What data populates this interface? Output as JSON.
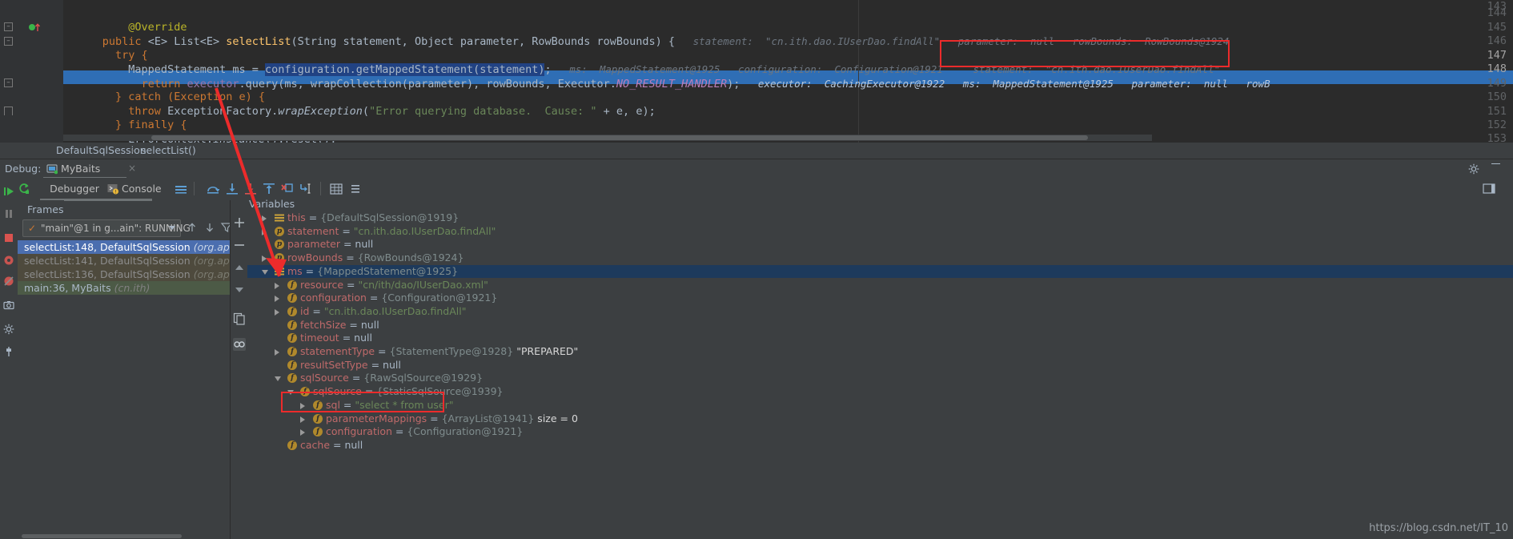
{
  "editor": {
    "lines": [
      {
        "num": "144",
        "indent": 0
      },
      {
        "num": "145",
        "indent": 0
      },
      {
        "num": "146",
        "indent": 0
      },
      {
        "num": "147",
        "indent": 0
      },
      {
        "num": "148",
        "indent": 0
      },
      {
        "num": "149",
        "indent": 0
      },
      {
        "num": "150",
        "indent": 0
      },
      {
        "num": "151",
        "indent": 0
      },
      {
        "num": "152",
        "indent": 0
      },
      {
        "num": "153",
        "indent": 0
      }
    ],
    "line144": {
      "annotation": "@Override"
    },
    "line145": {
      "kw_public": "public",
      "generic": " <E> ",
      "type": "List<E> ",
      "method": "selectList",
      "sig": "(String statement, Object parameter, RowBounds rowBounds) {",
      "hint1": "statement:  \"cn.ith.dao.IUserDao.findAll\"",
      "hint2": "parameter:  null",
      "hint3": "rowBounds:  RowBounds@1924"
    },
    "line146": {
      "text": "try {"
    },
    "line147": {
      "pre": "MappedStatement ms = ",
      "sel": "configuration.getMappedStatement(statement)",
      "post": ";",
      "hint1": "ms:  MappedStatement@1925",
      "hint2": "configuration:  Configuration@1921",
      "hint3": "statement:  \"cn.ith.dao.IUserDao.findAll\""
    },
    "line148": {
      "kw": "return ",
      "expr_a": "executor",
      "expr_b": ".query(ms, wrapCollection(parameter), rowBounds, Executor.",
      "const": "NO_RESULT_HANDLER",
      "expr_c": ");",
      "hint1": "executor:  CachingExecutor@1922",
      "hint2": "ms:  MappedStatement@1925",
      "hint3": "parameter:  null",
      "hint4": "rowB"
    },
    "line149": {
      "text": "} catch (Exception e) {"
    },
    "line150": {
      "kw": "throw ",
      "cls": "ExceptionFactory.",
      "method": "wrapException",
      "open": "(",
      "str": "\"Error querying database.  Cause: \"",
      "tail": " + e, e);"
    },
    "line151": {
      "text": "} finally {"
    },
    "line152": {
      "cls": "ErrorContext.",
      "method": "instance",
      "tail": "().reset();"
    },
    "line153": {
      "text": "}"
    }
  },
  "breadcrumb": {
    "class_name": "DefaultSqlSession",
    "separator": "›",
    "method_name": "selectList()"
  },
  "debug_header": {
    "label": "Debug:",
    "tab_name": "MyBaits",
    "close_label": "×",
    "settings_icon": "gear-icon",
    "minimize_icon": "minimize-icon"
  },
  "debug_tabs": [
    {
      "label": "Debugger",
      "active": true
    },
    {
      "label": "Console",
      "active": false
    }
  ],
  "toolbar_icons": [
    "show-execution-point-icon",
    "step-over-icon",
    "step-into-icon",
    "force-step-into-icon",
    "step-out-icon",
    "drop-frame-icon",
    "run-to-cursor-icon",
    "evaluate-expression-icon",
    "more-icon"
  ],
  "rail_icons": [
    "resume-program-icon",
    "pause-program-icon",
    "stop-icon",
    "view-breakpoints-icon",
    "mute-breakpoints-icon",
    "camera-icon",
    "settings-icon",
    "pin-icon"
  ],
  "frames": {
    "header": "Frames",
    "thread_selector": "\"main\"@1 in g...ain\": RUNNING",
    "items": [
      {
        "method": "selectList:148, DefaultSqlSession",
        "pkg": "(org.apache.ibatis.s",
        "state": "selected"
      },
      {
        "method": "selectList:141, DefaultSqlSession",
        "pkg": "(org.apache.ibatis.s",
        "state": "library"
      },
      {
        "method": "selectList:136, DefaultSqlSession",
        "pkg": "(org.apache.ibatis.s",
        "state": "library"
      },
      {
        "method": "main:36, MyBaits",
        "pkg": "(cn.ith)",
        "state": "user"
      }
    ]
  },
  "variables": {
    "header": "Variables",
    "rows": [
      {
        "indent": 0,
        "arrow": "closed",
        "icon": "localvar",
        "icon_char": "",
        "name": "this",
        "eq": " = ",
        "value": "{DefaultSqlSession@1919}",
        "vtype": "obj",
        "selected": false,
        "clipped": true
      },
      {
        "indent": 0,
        "arrow": "closed",
        "icon": "param",
        "icon_char": "p",
        "name": "statement",
        "eq": " = ",
        "value": "\"cn.ith.dao.IUserDao.findAll\"",
        "vtype": "str",
        "selected": false
      },
      {
        "indent": 0,
        "arrow": "none",
        "icon": "param",
        "icon_char": "p",
        "name": "parameter",
        "eq": " = ",
        "value": "null",
        "vtype": "null",
        "selected": false
      },
      {
        "indent": 0,
        "arrow": "closed",
        "icon": "param",
        "icon_char": "p",
        "name": "rowBounds",
        "eq": " = ",
        "value": "{RowBounds@1924}",
        "vtype": "obj",
        "selected": false
      },
      {
        "indent": 0,
        "arrow": "open",
        "icon": "localvar",
        "icon_char": "",
        "name": "ms",
        "eq": " = ",
        "value": "{MappedStatement@1925}",
        "vtype": "obj",
        "selected": true
      },
      {
        "indent": 1,
        "arrow": "closed",
        "icon": "field",
        "icon_char": "f",
        "name": "resource",
        "eq": " = ",
        "value": "\"cn/ith/dao/IUserDao.xml\"",
        "vtype": "str",
        "selected": false
      },
      {
        "indent": 1,
        "arrow": "closed",
        "icon": "field",
        "icon_char": "f",
        "name": "configuration",
        "eq": " = ",
        "value": "{Configuration@1921}",
        "vtype": "obj",
        "selected": false
      },
      {
        "indent": 1,
        "arrow": "closed",
        "icon": "field",
        "icon_char": "f",
        "name": "id",
        "eq": " = ",
        "value": "\"cn.ith.dao.IUserDao.findAll\"",
        "vtype": "str",
        "selected": false
      },
      {
        "indent": 1,
        "arrow": "none",
        "icon": "field",
        "icon_char": "f",
        "name": "fetchSize",
        "eq": " = ",
        "value": "null",
        "vtype": "null",
        "selected": false
      },
      {
        "indent": 1,
        "arrow": "none",
        "icon": "field",
        "icon_char": "f",
        "name": "timeout",
        "eq": " = ",
        "value": "null",
        "vtype": "null",
        "selected": false
      },
      {
        "indent": 1,
        "arrow": "closed",
        "icon": "field",
        "icon_char": "f",
        "name": "statementType",
        "eq": " = ",
        "value": "{StatementType@1928}",
        "vtype": "obj",
        "extra": "\"PREPARED\"",
        "selected": false
      },
      {
        "indent": 1,
        "arrow": "none",
        "icon": "field",
        "icon_char": "f",
        "name": "resultSetType",
        "eq": " = ",
        "value": "null",
        "vtype": "null",
        "selected": false
      },
      {
        "indent": 1,
        "arrow": "open",
        "icon": "field",
        "icon_char": "f",
        "name": "sqlSource",
        "eq": " = ",
        "value": "{RawSqlSource@1929}",
        "vtype": "obj",
        "selected": false
      },
      {
        "indent": 2,
        "arrow": "open",
        "icon": "field",
        "icon_char": "f",
        "name": "sqlSource",
        "eq": " = ",
        "value": "{StaticSqlSource@1939}",
        "vtype": "obj",
        "selected": false
      },
      {
        "indent": 3,
        "arrow": "closed",
        "icon": "field",
        "icon_char": "f",
        "name": "sql",
        "eq": " = ",
        "value": "\"select * from user\"",
        "vtype": "str",
        "selected": false,
        "highlighted": true
      },
      {
        "indent": 3,
        "arrow": "closed",
        "icon": "field",
        "icon_char": "f",
        "name": "parameterMappings",
        "eq": " = ",
        "value": "{ArrayList@1941}",
        "vtype": "obj",
        "extra": "size = 0",
        "selected": false
      },
      {
        "indent": 3,
        "arrow": "closed",
        "icon": "field",
        "icon_char": "f",
        "name": "configuration",
        "eq": " = ",
        "value": "{Configuration@1921}",
        "vtype": "obj",
        "selected": false
      },
      {
        "indent": 1,
        "arrow": "none",
        "icon": "field",
        "icon_char": "f",
        "name": "cache",
        "eq": " = ",
        "value": "null",
        "vtype": "null",
        "selected": false
      }
    ]
  },
  "annotations": {
    "red_box_code": "statement: \"cn.ith.dao.IUserDao.findAll\"",
    "red_box_variable": "sql = \"select * from user\"",
    "arrow_color": "#ec2b2b"
  },
  "watermark": {
    "text": "https://blog.csdn.net/IT_10"
  }
}
